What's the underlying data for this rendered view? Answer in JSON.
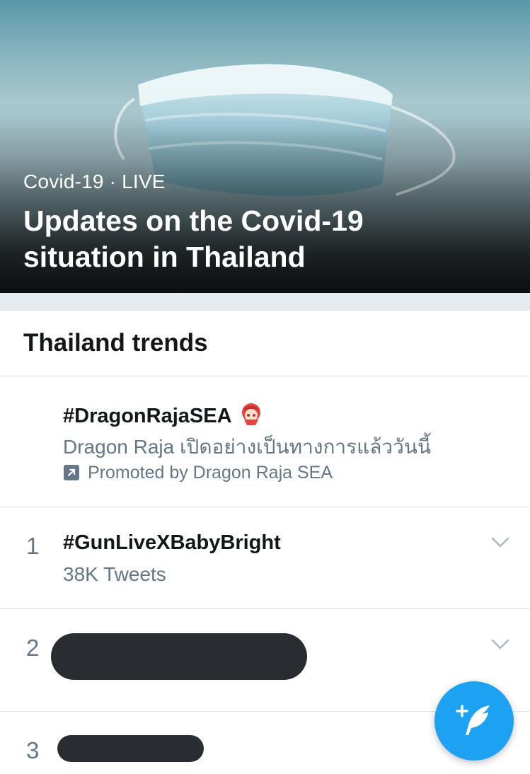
{
  "hero": {
    "category": "Covid-19",
    "separator": "·",
    "live_label": "LIVE",
    "title": "Updates on the Covid-19 situation in Thailand"
  },
  "trends": {
    "header": "Thailand trends",
    "promoted": {
      "hashtag": "#DragonRajaSEA",
      "description": "Dragon Raja เปิดอย่างเป็นทางการแล้ววันนี้",
      "promoted_by": "Promoted by Dragon Raja SEA"
    },
    "items": [
      {
        "rank": "1",
        "hashtag": "#GunLiveXBabyBright",
        "count": "38K Tweets"
      },
      {
        "rank": "2",
        "hashtag": "",
        "count": ""
      },
      {
        "rank": "3",
        "hashtag": "",
        "count": ""
      }
    ]
  },
  "colors": {
    "accent": "#1da1f2",
    "text_primary": "#14171a",
    "text_secondary": "#657786",
    "divider": "#e6ecf0"
  },
  "icons": {
    "promoted": "promoted-arrow-icon",
    "chevron": "chevron-down-icon",
    "compose": "compose-tweet-icon"
  }
}
